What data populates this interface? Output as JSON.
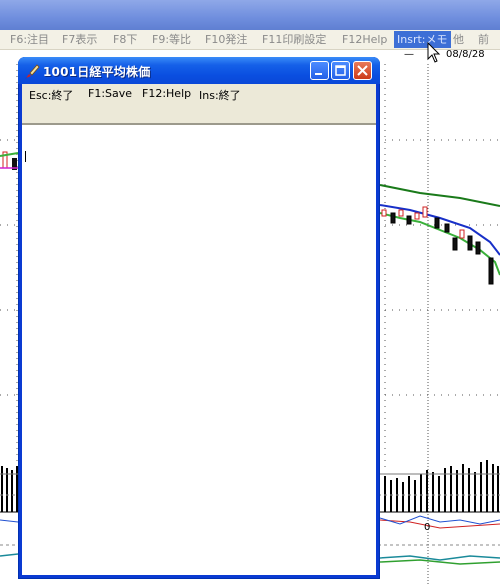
{
  "fkeys": [
    {
      "label": "F6:注目"
    },
    {
      "label": "F7表示"
    },
    {
      "label": "F8下"
    },
    {
      "label": "F9:等比"
    },
    {
      "label": "F10発注"
    },
    {
      "label": "F11印刷設定"
    },
    {
      "label": "F12Help"
    },
    {
      "label": "Insrt:メモ"
    },
    {
      "label": "他"
    },
    {
      "label": "前"
    }
  ],
  "chart": {
    "date": "08/8/28",
    "dash": "—"
  },
  "window": {
    "title": "1001日経平均株価",
    "menu": [
      "Esc:終了",
      "F1:Save",
      "F12:Help",
      "Ins:終了"
    ]
  },
  "colors": {
    "title_blue": "#0a4ee0",
    "accent": "#3d6fd6"
  },
  "icons": {
    "app": "brush-app-icon",
    "minimize": "minimize-icon",
    "maximize": "maximize-icon",
    "close": "close-icon",
    "cursor": "mouse-cursor-icon"
  }
}
